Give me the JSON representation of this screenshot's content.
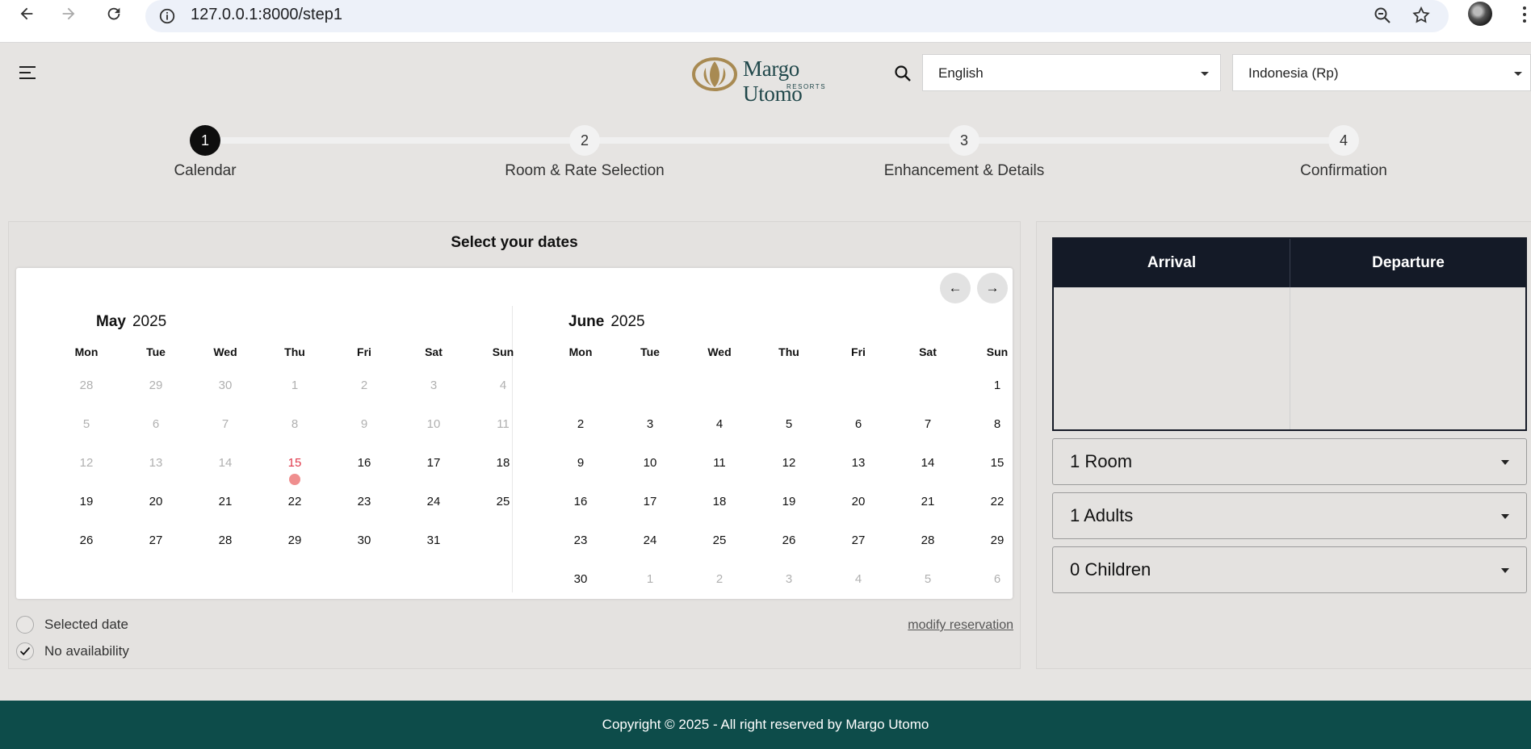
{
  "browser": {
    "url": "127.0.0.1:8000/step1"
  },
  "header": {
    "brand_name": "Margo Utomo",
    "brand_sub": "RESORTS",
    "language": "English",
    "currency": "Indonesia (Rp)"
  },
  "steps": [
    {
      "number": "1",
      "label": "Calendar"
    },
    {
      "number": "2",
      "label": "Room & Rate Selection"
    },
    {
      "number": "3",
      "label": "Enhancement & Details"
    },
    {
      "number": "4",
      "label": "Confirmation"
    }
  ],
  "calendar": {
    "title": "Select your dates",
    "prev": "←",
    "next": "→",
    "weekdays": [
      "Mon",
      "Tue",
      "Wed",
      "Thu",
      "Fri",
      "Sat",
      "Sun"
    ],
    "months": [
      {
        "name": "May",
        "year": "2025",
        "weeks": [
          [
            "28",
            "29",
            "30",
            "1",
            "2",
            "3",
            "4"
          ],
          [
            "5",
            "6",
            "7",
            "8",
            "9",
            "10",
            "11"
          ],
          [
            "12",
            "13",
            "14",
            "15",
            "16",
            "17",
            "18"
          ],
          [
            "19",
            "20",
            "21",
            "22",
            "23",
            "24",
            "25"
          ],
          [
            "26",
            "27",
            "28",
            "29",
            "30",
            "31",
            ""
          ]
        ]
      },
      {
        "name": "June",
        "year": "2025",
        "weeks": [
          [
            "",
            "",
            "",
            "",
            "",
            "",
            "1"
          ],
          [
            "2",
            "3",
            "4",
            "5",
            "6",
            "7",
            "8"
          ],
          [
            "9",
            "10",
            "11",
            "12",
            "13",
            "14",
            "15"
          ],
          [
            "16",
            "17",
            "18",
            "19",
            "20",
            "21",
            "22"
          ],
          [
            "23",
            "24",
            "25",
            "26",
            "27",
            "28",
            "29"
          ],
          [
            "30",
            "1",
            "2",
            "3",
            "4",
            "5",
            "6"
          ]
        ]
      }
    ],
    "today": "15",
    "legend_selected": "Selected date",
    "legend_unavailable": "No availability",
    "modify_link": "modify reservation"
  },
  "booking": {
    "arrival_label": "Arrival",
    "departure_label": "Departure",
    "rooms": "1 Room",
    "adults": "1 Adults",
    "children": "0 Children"
  },
  "footer": {
    "copyright": "Copyright © 2025 - All right reserved by Margo Utomo"
  }
}
